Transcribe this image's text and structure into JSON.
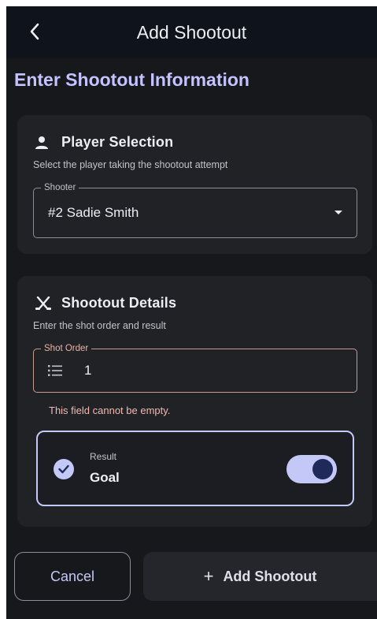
{
  "appbar": {
    "title": "Add Shootout",
    "back_icon": "chevron-left-icon"
  },
  "section_title": "Enter Shootout Information",
  "player_card": {
    "title": "Player Selection",
    "icon": "person-icon",
    "subtitle": "Select the player taking the shootout attempt",
    "shooter_label": "Shooter",
    "shooter_value": "#2 Sadie Smith"
  },
  "details_card": {
    "title": "Shootout Details",
    "icon": "crossed-sticks-icon",
    "subtitle": "Enter the shot order and result",
    "shot_order_label": "Shot Order",
    "shot_order_value": "1",
    "error": "This field cannot be empty.",
    "result_label": "Result",
    "result_value": "Goal",
    "result_toggle_on": true
  },
  "actions": {
    "cancel": "Cancel",
    "add_plus": "+",
    "add": "Add Shootout"
  },
  "colors": {
    "accent": "#c4c8f6",
    "heading": "#c4c3ff",
    "error": "#f2b8b0",
    "background": "#17181c"
  }
}
